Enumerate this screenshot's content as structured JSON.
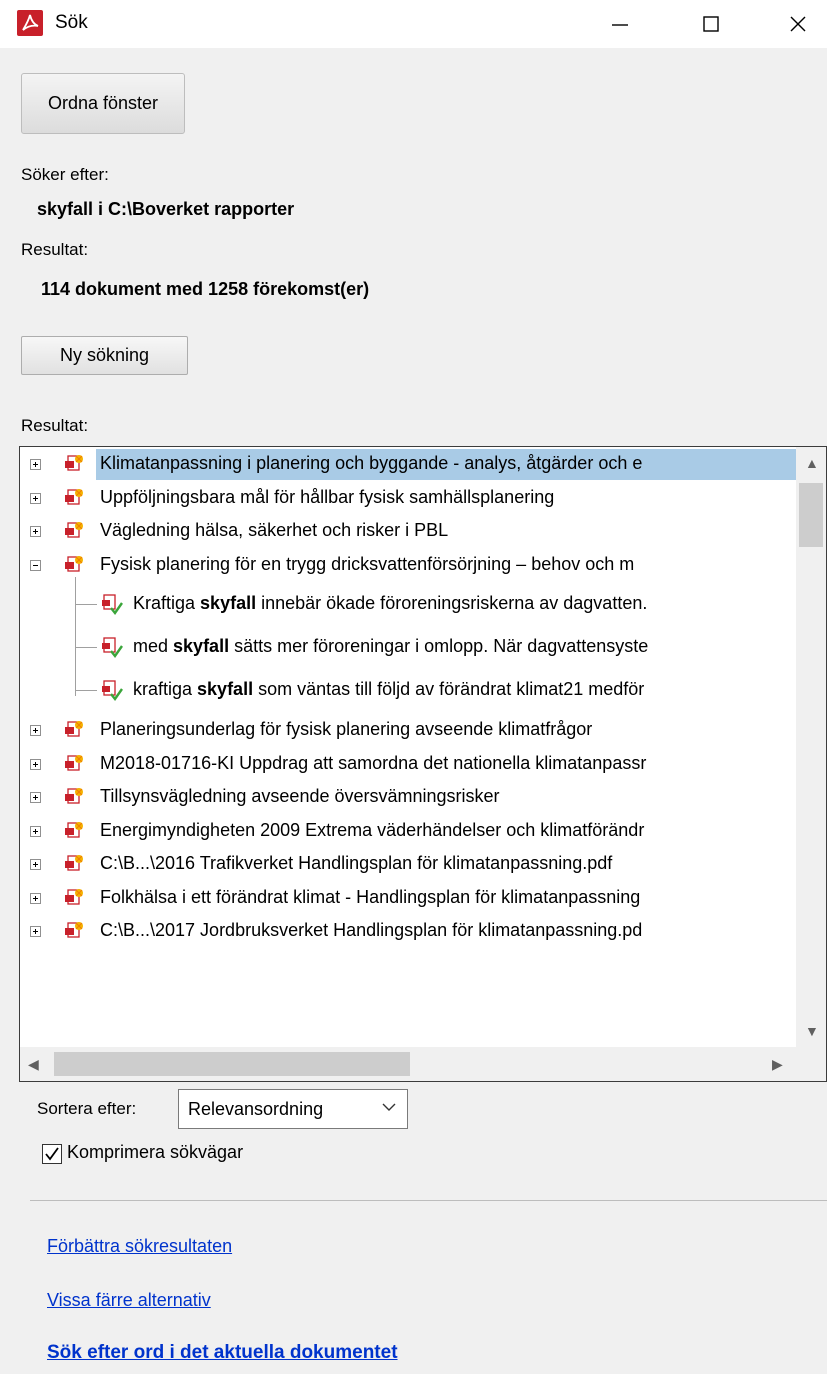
{
  "window": {
    "title": "Sök"
  },
  "toolbar": {
    "arrange_label": "Ordna fönster"
  },
  "search": {
    "searching_for_label": "Söker efter:",
    "query": "skyfall i C:\\Boverket rapporter",
    "results_label": "Resultat:",
    "summary": "114 dokument med 1258 förekomst(er)",
    "new_search_label": "Ny sökning",
    "results_list_label": "Resultat:"
  },
  "results": {
    "documents": [
      {
        "label": "Klimatanpassning i planering och byggande - analys, åtgärder och e",
        "expanded": false,
        "selected": true
      },
      {
        "label": "Uppföljningsbara mål för hållbar fysisk samhällsplanering",
        "expanded": false
      },
      {
        "label": "Vägledning hälsa, säkerhet och risker i PBL",
        "expanded": false
      },
      {
        "label": "Fysisk planering för en trygg dricksvattenförsörjning – behov och m",
        "expanded": true
      },
      {
        "label": "Planeringsunderlag för fysisk planering avseende klimatfrågor",
        "expanded": false
      },
      {
        "label": "M2018-01716-KI Uppdrag att samordna det nationella klimatanpassr",
        "expanded": false
      },
      {
        "label": "Tillsynsvägledning avseende översvämningsrisker",
        "expanded": false
      },
      {
        "label": "Energimyndigheten 2009 Extrema väderhändelser och klimatförändr",
        "expanded": false
      },
      {
        "label": "C:\\B...\\2016 Trafikverket Handlingsplan för klimatanpassning.pdf",
        "expanded": false
      },
      {
        "label": "Folkhälsa i ett förändrat klimat - Handlingsplan för klimatanpassning",
        "expanded": false
      },
      {
        "label": "C:\\B...\\2017 Jordbruksverket Handlingsplan för klimatanpassning.pd",
        "expanded": false
      }
    ],
    "hits": [
      {
        "before": "Kraftiga ",
        "term": "skyfall",
        "after": " innebär ökade föroreningsriskerna av dagvatten."
      },
      {
        "before": "med ",
        "term": "skyfall",
        "after": " sätts mer föroreningar i omlopp. När dagvattensyste"
      },
      {
        "before": "kraftiga ",
        "term": "skyfall",
        "after": " som väntas till följd av förändrat klimat21 medför"
      }
    ]
  },
  "sort": {
    "label": "Sortera efter:",
    "value": "Relevansordning"
  },
  "compress": {
    "label": "Komprimera sökvägar",
    "checked": true
  },
  "links": {
    "improve": "Förbättra sökresultaten",
    "fewer_options": "Vissa färre alternativ",
    "search_current": "Sök efter ord i det aktuella dokumentet"
  },
  "colors": {
    "accent": "#c8202a",
    "selection": "#a9cbe6",
    "link": "#0033cc"
  }
}
